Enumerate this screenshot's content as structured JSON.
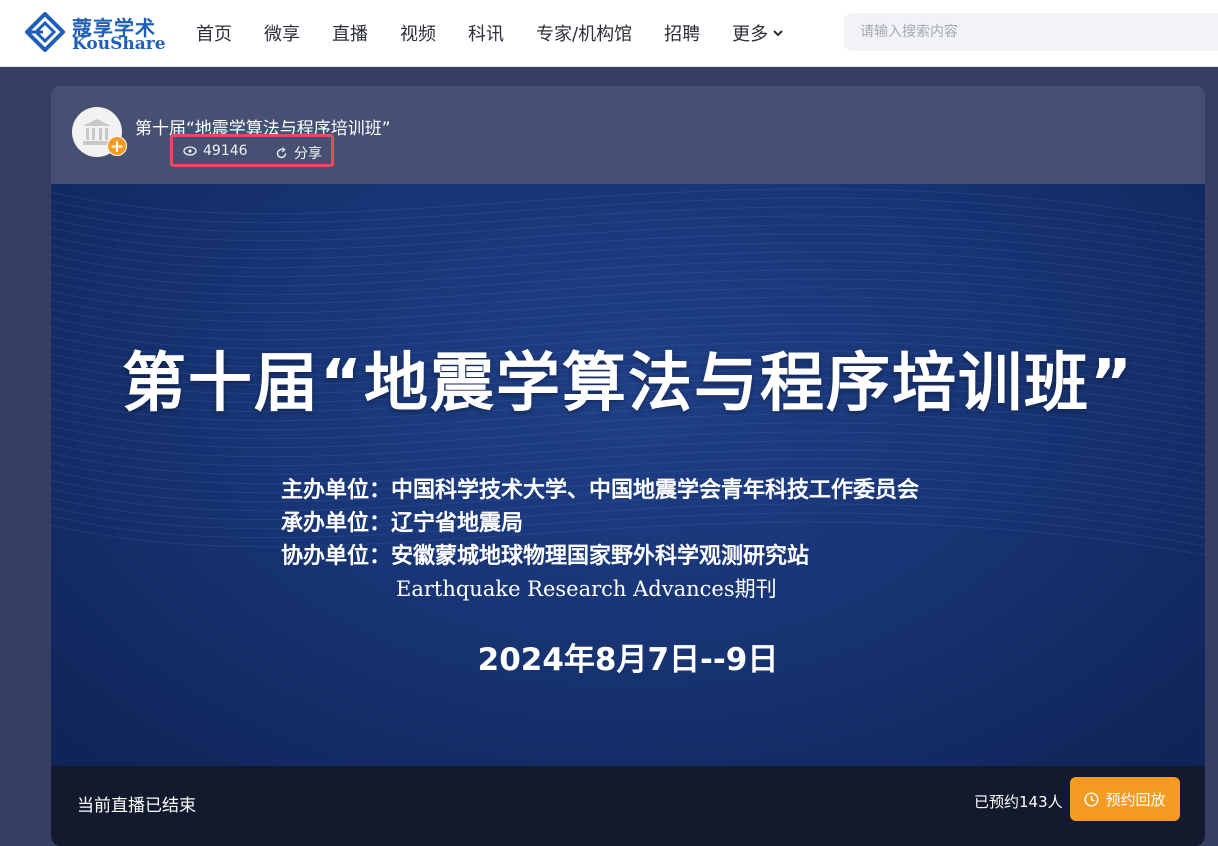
{
  "brand": {
    "name_cn": "蔻享学术",
    "name_en": "KouShare",
    "color": "#1f5fb8"
  },
  "nav": {
    "items": [
      "首页",
      "微享",
      "直播",
      "视频",
      "科讯",
      "专家/机构馆",
      "招聘"
    ],
    "more_label": "更多"
  },
  "search": {
    "placeholder": "请输入搜索内容",
    "value": ""
  },
  "live": {
    "title": "第十届“地震学算法与程序培训班”",
    "views": "49146",
    "share_label": "分享",
    "highlight_color": "#e8495d"
  },
  "poster": {
    "title": "第十届“地震学算法与程序培训班”",
    "organizers": [
      "主办单位：中国科学技术大学、中国地震学会青年科技工作委员会",
      "承办单位：辽宁省地震局",
      "协办单位：安徽蒙城地球物理国家野外科学观测研究站"
    ],
    "journal": "Earthquake Research Advances期刊",
    "date": "2024年8月7日--9日"
  },
  "status": {
    "ended_text": "当前直播已结束",
    "booked_text": "已预约143人",
    "replay_button": "预约回放",
    "accent": "#f59a23"
  }
}
